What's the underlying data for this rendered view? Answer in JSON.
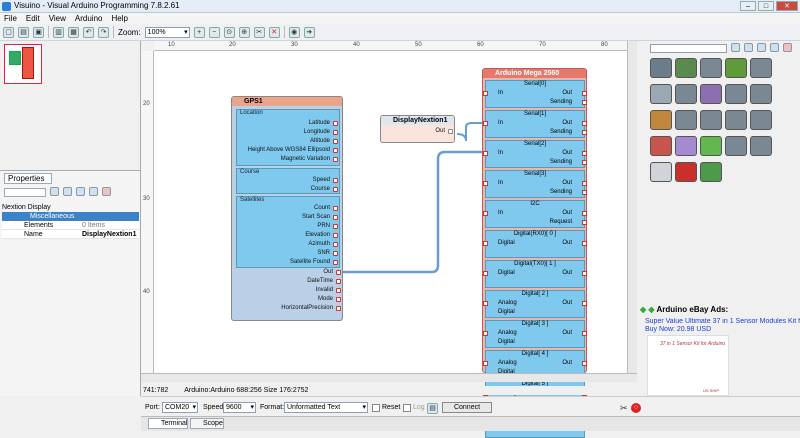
{
  "window": {
    "title": "Visuino - Visual Arduino Programming 7.8.2.61"
  },
  "menu": [
    "File",
    "Edit",
    "View",
    "Arduino",
    "Help"
  ],
  "toolbar": {
    "zoom_label": "Zoom:",
    "zoom_value": "100%"
  },
  "ruler": {
    "top": [
      "10",
      "20",
      "30",
      "40",
      "50",
      "60",
      "70",
      "80"
    ],
    "left": [
      "20",
      "30",
      "40"
    ]
  },
  "properties": {
    "tab": "Properties",
    "object": "Nextion Display",
    "category": "Miscellaneous",
    "rows": [
      {
        "key": "Elements",
        "value": "0 Items"
      },
      {
        "key": "Name",
        "value": "DisplayNextion1"
      }
    ]
  },
  "gps": {
    "title": "GPS1",
    "sections": [
      {
        "label": "Location",
        "pins": [
          "Latitude",
          "Longitude",
          "Altitude",
          "Height Above WGS84 Ellipsoid",
          "Magnetic Variation"
        ]
      },
      {
        "label": "Course",
        "pins": [
          "Speed",
          "Course"
        ]
      },
      {
        "label": "Satellites",
        "pins": [
          "Count",
          "Start Scan",
          "PRN",
          "Elevation",
          "Azimuth",
          "SNR",
          "Satellite Found"
        ]
      }
    ],
    "bottom_pins": [
      "Out",
      "DateTime",
      "Invalid",
      "Mode",
      "HorizontalPrecision"
    ]
  },
  "nextion": {
    "title": "DisplayNextion1",
    "out": "Out"
  },
  "mega": {
    "title": "Arduino Mega 2560",
    "rows": [
      {
        "title": "Serial[0]",
        "l1": "In",
        "r1": "Out",
        "r2": "Sending"
      },
      {
        "title": "Serial[1]",
        "l1": "In",
        "r1": "Out",
        "r2": "Sending"
      },
      {
        "title": "Serial[2]",
        "l1": "In",
        "r1": "Out",
        "r2": "Sending"
      },
      {
        "title": "Serial[3]",
        "l1": "In",
        "r1": "Out",
        "r2": "Sending"
      },
      {
        "title": "I2C",
        "l1": "In",
        "r1": "Out",
        "r2": "Request"
      },
      {
        "title": "Digital(RX0)[ 0 ]",
        "l1": "Digital",
        "r1": "Out",
        "r2": ""
      },
      {
        "title": "Digital(TX0)[ 1 ]",
        "l1": "Digital",
        "r1": "Out",
        "r2": ""
      },
      {
        "title": "Digital[ 2 ]",
        "l1": "Analog",
        "l2": "Digital",
        "r1": "Out",
        "r2": ""
      },
      {
        "title": "Digital[ 3 ]",
        "l1": "Analog",
        "l2": "Digital",
        "r1": "Out",
        "r2": ""
      },
      {
        "title": "Digital[ 4 ]",
        "l1": "Analog",
        "l2": "Digital",
        "r1": "Out",
        "r2": ""
      },
      {
        "title": "Digital[ 5 ]",
        "l1": "Analog",
        "l2": "Digital",
        "r1": "Out",
        "r2": ""
      },
      {
        "title": "Digital[ 6 ]",
        "l1": "",
        "r1": "Out",
        "r2": ""
      }
    ]
  },
  "ebay": {
    "heading": "Arduino eBay Ads:",
    "link": "Super Value Ultimate 37 in 1 Sensor Modules Kit for Ardu",
    "price": "Buy Now: 20.98 USD",
    "image_caption": "37 in 1 Sensor Kit for Arduino",
    "image_tag": "US SHIP"
  },
  "status": {
    "coords": "741:782",
    "info": "Arduino:Arduino 688:256 Size 176:2752"
  },
  "connection": {
    "port_label": "Port:",
    "port": "COM20",
    "speed_label": "Speed:",
    "speed": "9600",
    "format_label": "Format:",
    "format": "Unformatted Text",
    "reset": "Reset",
    "log": "Log",
    "connect": "Connect"
  },
  "tabs": [
    "Terminal",
    "Scope"
  ],
  "colors": {
    "accent": "#3b82c9",
    "pin_blue": "#7fc9ee",
    "header_red": "#e4796c"
  }
}
